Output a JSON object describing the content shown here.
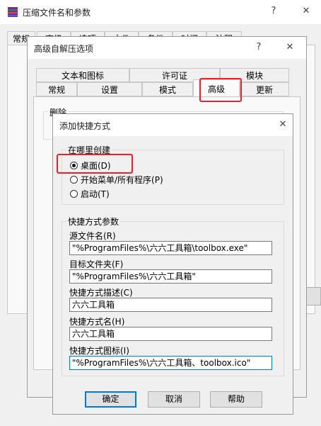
{
  "main_window": {
    "title": "压缩文件名和参数",
    "help_label": "?",
    "close_label": "✕",
    "tabs_visible": [
      "常规",
      "高级",
      "选项",
      "文件",
      "备份",
      "时间",
      "注释"
    ]
  },
  "advanced_window": {
    "title": "高级自解压选项",
    "help_label": "?",
    "close_label": "✕",
    "tabs_row1": [
      "文本和图标",
      "许可证",
      "模块"
    ],
    "tabs_row2": [
      "常规",
      "设置",
      "模式",
      "高级",
      "更新"
    ],
    "delete_group_label": "删除"
  },
  "shortcut_dialog": {
    "title": "添加快捷方式",
    "close_label": "✕",
    "location_group": "在哪里创建",
    "options": [
      {
        "label": "桌面(D)",
        "selected": true
      },
      {
        "label": "开始菜单/所有程序(P)",
        "selected": false
      },
      {
        "label": "启动(T)",
        "selected": false
      }
    ],
    "params_group": "快捷方式参数",
    "fields": {
      "source_label": "源文件名(R)",
      "source_value": "\"%ProgramFiles%\\六六工具箱\\toolbox.exe\"",
      "target_label": "目标文件夹(F)",
      "target_value": "\"%ProgramFiles%\\六六工具箱\"",
      "desc_label": "快捷方式描述(C)",
      "desc_value": "六六工具箱",
      "name_label": "快捷方式名(H)",
      "name_value": "六六工具箱",
      "icon_label": "快捷方式图标(I)",
      "icon_value": "\"%ProgramFiles%\\六六工具箱、toolbox.ico\""
    },
    "buttons": {
      "ok": "确定",
      "cancel": "取消",
      "help": "帮助"
    }
  },
  "colors": {
    "highlight": "#e8212a",
    "focus": "#0078d7"
  }
}
